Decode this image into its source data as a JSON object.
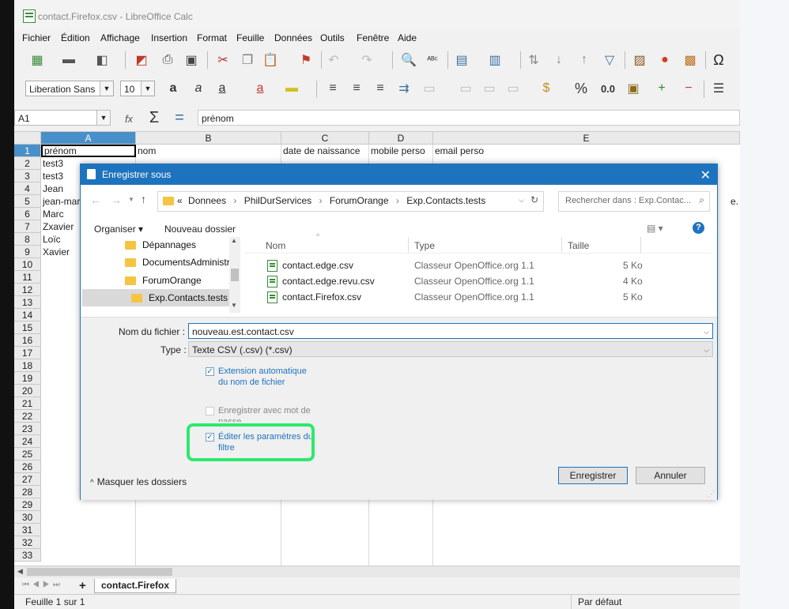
{
  "window": {
    "title": "contact.Firefox.csv - LibreOffice Calc"
  },
  "menus": [
    "Fichier",
    "Édition",
    "Affichage",
    "Insertion",
    "Format",
    "Feuille",
    "Données",
    "Outils",
    "Fenêtre",
    "Aide"
  ],
  "format_bar": {
    "font_name": "Liberation Sans",
    "font_size": "10",
    "percent": "%",
    "decimal": "0.0"
  },
  "formula_bar": {
    "cell_ref": "A1",
    "sigma": "Σ",
    "equals": "=",
    "content": "prénom"
  },
  "columns": [
    "A",
    "B",
    "C",
    "D",
    "E"
  ],
  "rows": [
    "1",
    "2",
    "3",
    "4",
    "5",
    "6",
    "7",
    "8",
    "9",
    "10",
    "11",
    "12",
    "13",
    "14",
    "15",
    "16",
    "17",
    "18",
    "19",
    "20",
    "21",
    "22",
    "23",
    "24",
    "25",
    "26",
    "27",
    "28",
    "29",
    "30",
    "31",
    "32",
    "33"
  ],
  "cells": {
    "header": [
      "prénom",
      "nom",
      "date de naissance",
      "mobile perso",
      "email perso"
    ],
    "col_a": [
      "test3",
      "test3",
      "Jean",
      "jean-martin-",
      "Marc",
      "Zxavier",
      "Loïc",
      "Xavier"
    ],
    "e5_overflow": "e."
  },
  "sheet_tabs": {
    "active": "contact.Firefox",
    "add": "+"
  },
  "status": {
    "sheet": "Feuille 1 sur 1",
    "style": "Par défaut"
  },
  "dialog": {
    "title": "Enregistrer sous",
    "breadcrumb": [
      "«",
      "Donnees",
      "PhilDurServices",
      "ForumOrange",
      "Exp.Contacts.tests"
    ],
    "search_placeholder": "Rechercher dans : Exp.Contac...",
    "organize": "Organiser ▾",
    "new_folder": "Nouveau dossier",
    "nav_items": [
      "Dépannages",
      "DocumentsAdministrat",
      "ForumOrange",
      "Exp.Contacts.tests"
    ],
    "columns": {
      "name": "Nom",
      "type": "Type",
      "size": "Taille"
    },
    "files": [
      {
        "name": "contact.edge.csv",
        "type": "Classeur OpenOffice.org 1.1",
        "size": "5 Ko"
      },
      {
        "name": "contact.edge.revu.csv",
        "type": "Classeur OpenOffice.org 1.1",
        "size": "4 Ko"
      },
      {
        "name": "contact.Firefox.csv",
        "type": "Classeur OpenOffice.org 1.1",
        "size": "5 Ko"
      }
    ],
    "filename_label": "Nom du fichier :",
    "filename_value": "nouveau.est.contact.csv",
    "type_label": "Type :",
    "type_value": "Texte CSV (.csv) (*.csv)",
    "opt_extension": "Extension automatique du nom de fichier",
    "opt_password": "Enregistrer avec mot de passe",
    "opt_filter": "Éditer les paramètres du filtre",
    "hide_folders": "Masquer les dossiers",
    "save_button": "Enregistrer",
    "cancel_button": "Annuler"
  },
  "colors": {
    "accent": "#1e73be",
    "highlight": "#2ee86e",
    "selected_header": "#4a90c8"
  }
}
